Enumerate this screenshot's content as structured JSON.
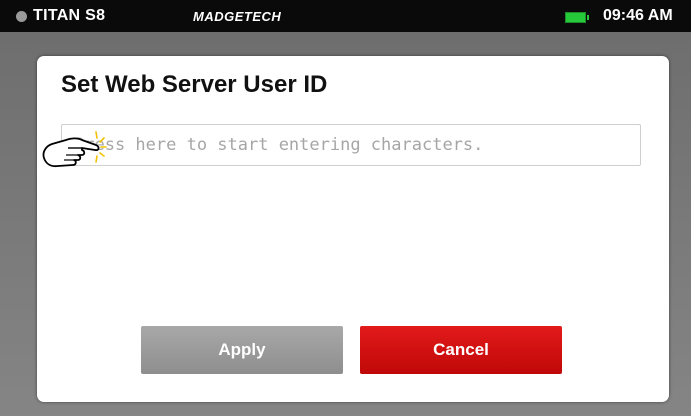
{
  "status_bar": {
    "device_name": "TITAN S8",
    "brand": "MADGETECH",
    "time": "09:46 AM",
    "battery_color": "#25c93a",
    "icons": [
      "status-dot-icon",
      "battery-icon"
    ]
  },
  "dialog": {
    "title": "Set Web Server User ID",
    "input_value": "",
    "input_placeholder": "Press here to start entering characters.",
    "apply_label": "Apply",
    "cancel_label": "Cancel",
    "apply_color": "#9b9b9b",
    "cancel_color": "#d01010"
  },
  "overlay": {
    "icon": "pointing-hand-icon"
  }
}
